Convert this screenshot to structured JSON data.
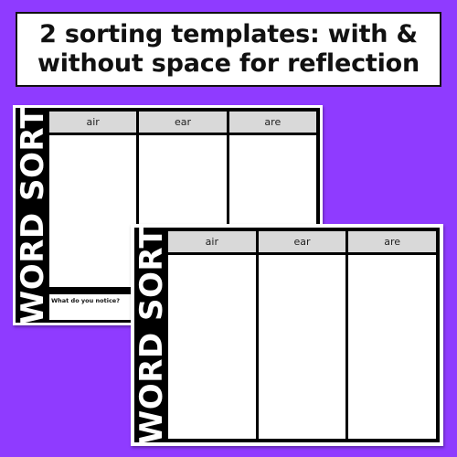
{
  "banner": {
    "line1": "2 sorting templates: with &",
    "line2": "without space for reflection"
  },
  "colors": {
    "background": "#8f3bff",
    "header_fill": "#d9d9d9",
    "frame": "#000000"
  },
  "templates": [
    {
      "variant": "with reflection",
      "side_title": "WORD SORT",
      "columns": [
        "air",
        "ear",
        "are"
      ],
      "reflection_prompt": "What do you notice?"
    },
    {
      "variant": "without reflection",
      "side_title": "WORD SORT",
      "columns": [
        "air",
        "ear",
        "are"
      ]
    }
  ]
}
